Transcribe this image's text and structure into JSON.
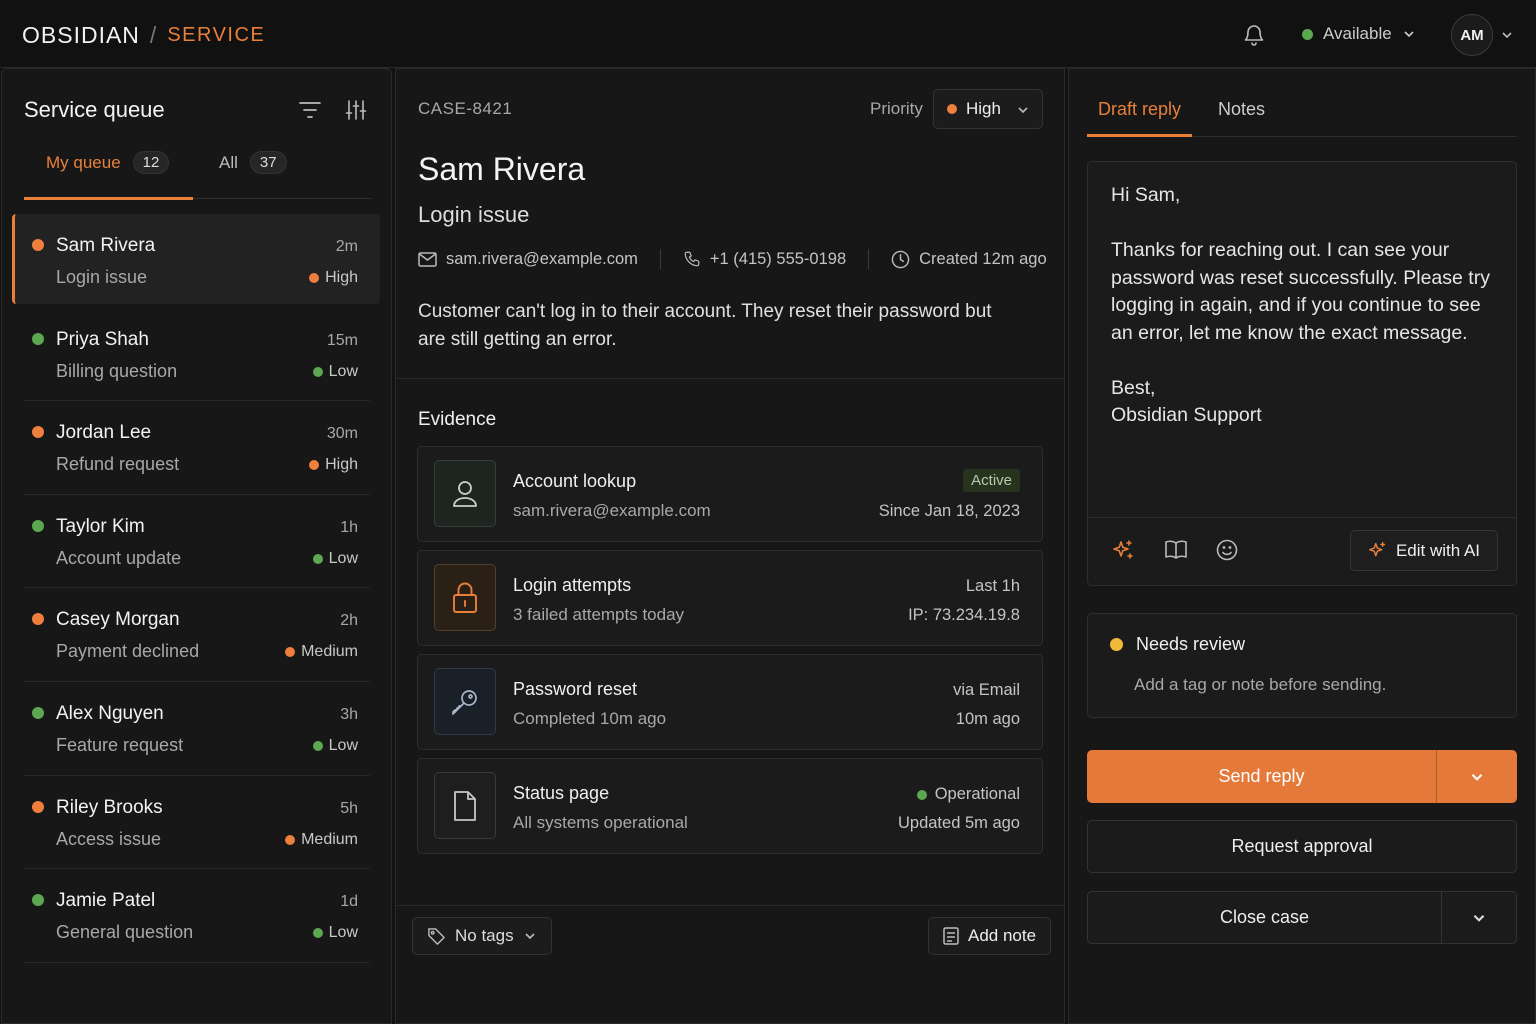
{
  "brand": {
    "name": "OBSIDIAN",
    "separator": "/",
    "section": "SERVICE"
  },
  "header": {
    "status": "Available",
    "status_color": "#5ca850",
    "avatar_initials": "AM"
  },
  "colors": {
    "accent": "#e8803a",
    "high": "#ee7f3d",
    "low": "#5ca850",
    "medium": "#ee7f3d",
    "warning": "#f0b93a"
  },
  "queue": {
    "title": "Service queue",
    "tabs": [
      {
        "label": "My queue",
        "count": "12"
      },
      {
        "label": "All",
        "count": "37"
      }
    ],
    "items": [
      {
        "name": "Sam Rivera",
        "subject": "Login issue",
        "time": "2m",
        "priority": "High",
        "status_color": "#ee7f3d",
        "priority_color": "#ee7f3d"
      },
      {
        "name": "Priya Shah",
        "subject": "Billing question",
        "time": "15m",
        "priority": "Low",
        "status_color": "#5ca850",
        "priority_color": "#5ca850"
      },
      {
        "name": "Jordan Lee",
        "subject": "Refund request",
        "time": "30m",
        "priority": "High",
        "status_color": "#ee7f3d",
        "priority_color": "#ee7f3d"
      },
      {
        "name": "Taylor Kim",
        "subject": "Account update",
        "time": "1h",
        "priority": "Low",
        "status_color": "#5ca850",
        "priority_color": "#5ca850"
      },
      {
        "name": "Casey Morgan",
        "subject": "Payment declined",
        "time": "2h",
        "priority": "Medium",
        "status_color": "#ee7f3d",
        "priority_color": "#ee7f3d"
      },
      {
        "name": "Alex Nguyen",
        "subject": "Feature request",
        "time": "3h",
        "priority": "Low",
        "status_color": "#5ca850",
        "priority_color": "#5ca850"
      },
      {
        "name": "Riley Brooks",
        "subject": "Access issue",
        "time": "5h",
        "priority": "Medium",
        "status_color": "#ee7f3d",
        "priority_color": "#ee7f3d"
      },
      {
        "name": "Jamie Patel",
        "subject": "General question",
        "time": "1d",
        "priority": "Low",
        "status_color": "#5ca850",
        "priority_color": "#5ca850"
      }
    ]
  },
  "case": {
    "id": "CASE-8421",
    "priority_label": "Priority",
    "priority_value": "High",
    "customer_name": "Sam Rivera",
    "subject": "Login issue",
    "email": "sam.rivera@example.com",
    "phone": "+1 (415) 555-0198",
    "created": "Created 12m ago",
    "description": "Customer can't log in to their account. They reset their password but are still getting an error.",
    "evidence_title": "Evidence",
    "evidence": [
      {
        "icon": "user-icon",
        "title": "Account lookup",
        "subtitle": "sam.rivera@example.com",
        "right_top": "Active",
        "right_bottom": "Since Jan 18, 2023"
      },
      {
        "icon": "lock-icon",
        "title": "Login attempts",
        "subtitle": "3 failed attempts today",
        "right_top": "Last 1h",
        "right_bottom": "IP: 73.234.19.8"
      },
      {
        "icon": "key-icon",
        "title": "Password reset",
        "subtitle": "Completed 10m ago",
        "right_top": "via Email",
        "right_bottom": "10m ago"
      },
      {
        "icon": "document-icon",
        "title": "Status page",
        "subtitle": "All systems operational",
        "right_top": "Operational",
        "right_bottom": "Updated 5m ago"
      }
    ],
    "tags_label": "No tags",
    "add_note_label": "Add note"
  },
  "reply": {
    "tabs": [
      "Draft reply",
      "Notes"
    ],
    "draft": "Hi Sam,\n\nThanks for reaching out. I can see your password was reset successfully. Please try logging in again, and if you continue to see an error, let me know the exact message.\n\nBest,\nObsidian Support",
    "edit_ai_label": "Edit with AI",
    "review_title": "Needs review",
    "review_subtitle": "Add a tag or note before sending.",
    "send_label": "Send reply",
    "request_label": "Request approval",
    "close_label": "Close case"
  }
}
